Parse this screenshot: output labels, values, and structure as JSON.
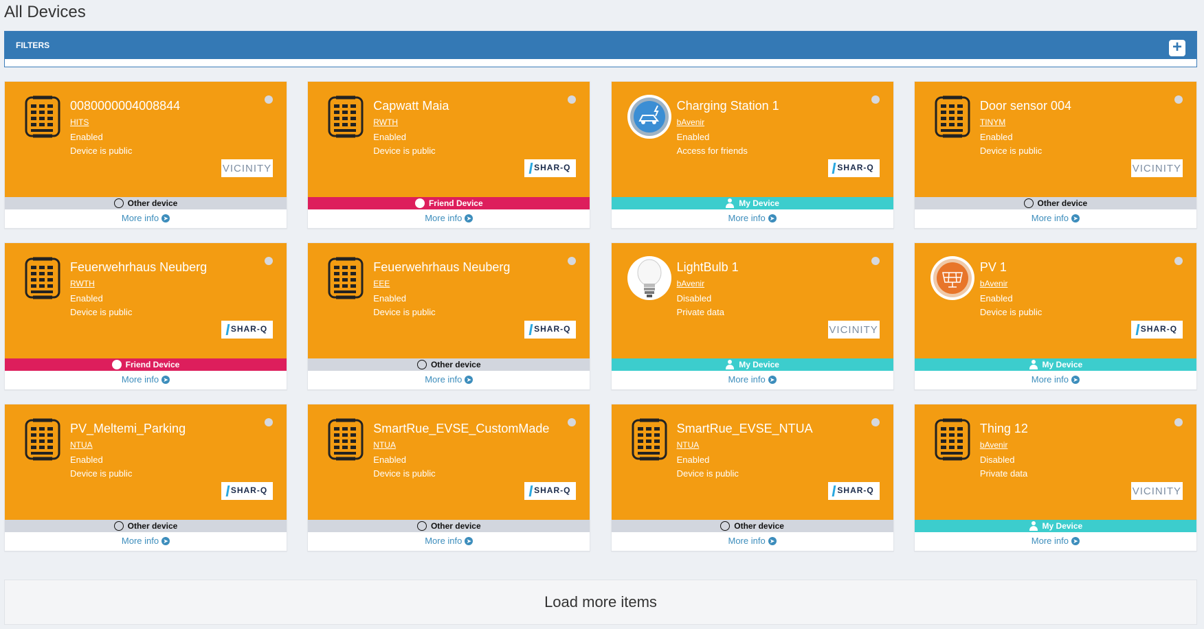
{
  "page": {
    "title": "All Devices"
  },
  "filters": {
    "label": "FILTERS",
    "add_icon": "plus-square-icon"
  },
  "colors": {
    "card": "#f39c12",
    "header": "#3479b5",
    "other": "#d2d6de",
    "friend": "#dd1e5c",
    "mine": "#3ccdcd",
    "link": "#3c8dbc"
  },
  "devices": [
    {
      "name": "0080000004008844",
      "owner": "HITS",
      "state": "Enabled",
      "access": "Device is public",
      "platform": "VICINITY",
      "relation": "Other device",
      "rel_type": "other",
      "icon": "keypad-icon",
      "more": "More info"
    },
    {
      "name": "Capwatt Maia",
      "owner": "RWTH",
      "state": "Enabled",
      "access": "Device is public",
      "platform": "SHAR-Q",
      "relation": "Friend Device",
      "rel_type": "friend",
      "icon": "keypad-icon",
      "more": "More info"
    },
    {
      "name": "Charging Station 1",
      "owner": "bAvenir",
      "state": "Enabled",
      "access": "Access for friends",
      "platform": "SHAR-Q",
      "relation": "My Device",
      "rel_type": "mine",
      "icon": "charging-car-icon",
      "more": "More info"
    },
    {
      "name": "Door sensor 004",
      "owner": "TINYM",
      "state": "Enabled",
      "access": "Device is public",
      "platform": "VICINITY",
      "relation": "Other device",
      "rel_type": "other",
      "icon": "keypad-icon",
      "more": "More info"
    },
    {
      "name": "Feuerwehrhaus Neuberg",
      "owner": "RWTH",
      "state": "Enabled",
      "access": "Device is public",
      "platform": "SHAR-Q",
      "relation": "Friend Device",
      "rel_type": "friend",
      "icon": "keypad-icon",
      "more": "More info"
    },
    {
      "name": "Feuerwehrhaus Neuberg",
      "owner": "EEE",
      "state": "Enabled",
      "access": "Device is public",
      "platform": "SHAR-Q",
      "relation": "Other device",
      "rel_type": "other",
      "icon": "keypad-icon",
      "more": "More info"
    },
    {
      "name": "LightBulb 1",
      "owner": "bAvenir",
      "state": "Disabled",
      "access": "Private data",
      "platform": "VICINITY",
      "relation": "My Device",
      "rel_type": "mine",
      "icon": "lightbulb-icon",
      "more": "More info"
    },
    {
      "name": "PV 1",
      "owner": "bAvenir",
      "state": "Enabled",
      "access": "Device is public",
      "platform": "SHAR-Q",
      "relation": "My Device",
      "rel_type": "mine",
      "icon": "solar-panel-icon",
      "more": "More info"
    },
    {
      "name": "PV_Meltemi_Parking",
      "owner": "NTUA",
      "state": "Enabled",
      "access": "Device is public",
      "platform": "SHAR-Q",
      "relation": "Other device",
      "rel_type": "other",
      "icon": "keypad-icon",
      "more": "More info"
    },
    {
      "name": "SmartRue_EVSE_CustomMade",
      "owner": "NTUA",
      "state": "Enabled",
      "access": "Device is public",
      "platform": "SHAR-Q",
      "relation": "Other device",
      "rel_type": "other",
      "icon": "keypad-icon",
      "more": "More info"
    },
    {
      "name": "SmartRue_EVSE_NTUA",
      "owner": "NTUA",
      "state": "Enabled",
      "access": "Device is public",
      "platform": "SHAR-Q",
      "relation": "Other device",
      "rel_type": "other",
      "icon": "keypad-icon",
      "more": "More info"
    },
    {
      "name": "Thing 12",
      "owner": "bAvenir",
      "state": "Disabled",
      "access": "Private data",
      "platform": "VICINITY",
      "relation": "My Device",
      "rel_type": "mine",
      "icon": "keypad-icon",
      "more": "More info"
    }
  ],
  "load_more": {
    "label": "Load more items"
  }
}
